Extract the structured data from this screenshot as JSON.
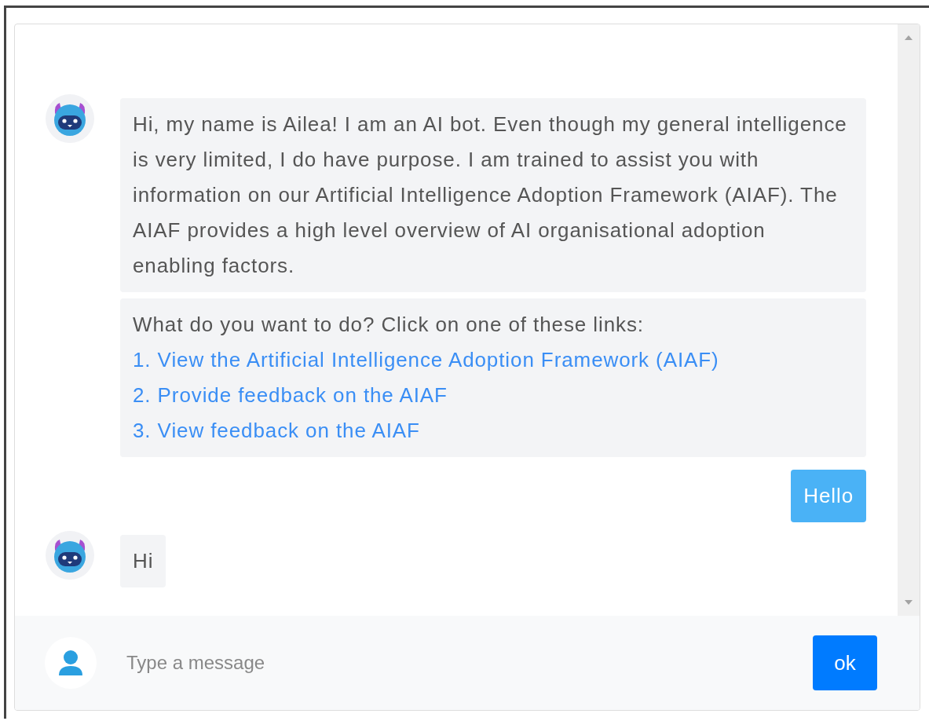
{
  "messages": [
    {
      "kind": "bot",
      "blocks": [
        {
          "kind": "text",
          "text": "Hi, my name is Ailea! I am an AI bot. Even though my general intelligence is very limited, I do have purpose. I am trained to assist you with information on our Artificial Intelligence Adoption Framework (AIAF). The AIAF provides a high level overview of AI organisational adoption enabling factors."
        },
        {
          "kind": "menu",
          "prompt": "What do you want to do? Click on one of these links:",
          "links": [
            "1. View the Artificial Intelligence Adoption Framework (AIAF)",
            "2. Provide feedback on the AIAF",
            "3. View feedback on the AIAF"
          ]
        }
      ]
    },
    {
      "kind": "user",
      "blocks": [
        {
          "kind": "text",
          "text": "Hello"
        }
      ]
    },
    {
      "kind": "bot",
      "blocks": [
        {
          "kind": "text",
          "text": "Hi"
        }
      ]
    }
  ],
  "composer": {
    "placeholder": "Type a message",
    "send_button": "ok"
  }
}
